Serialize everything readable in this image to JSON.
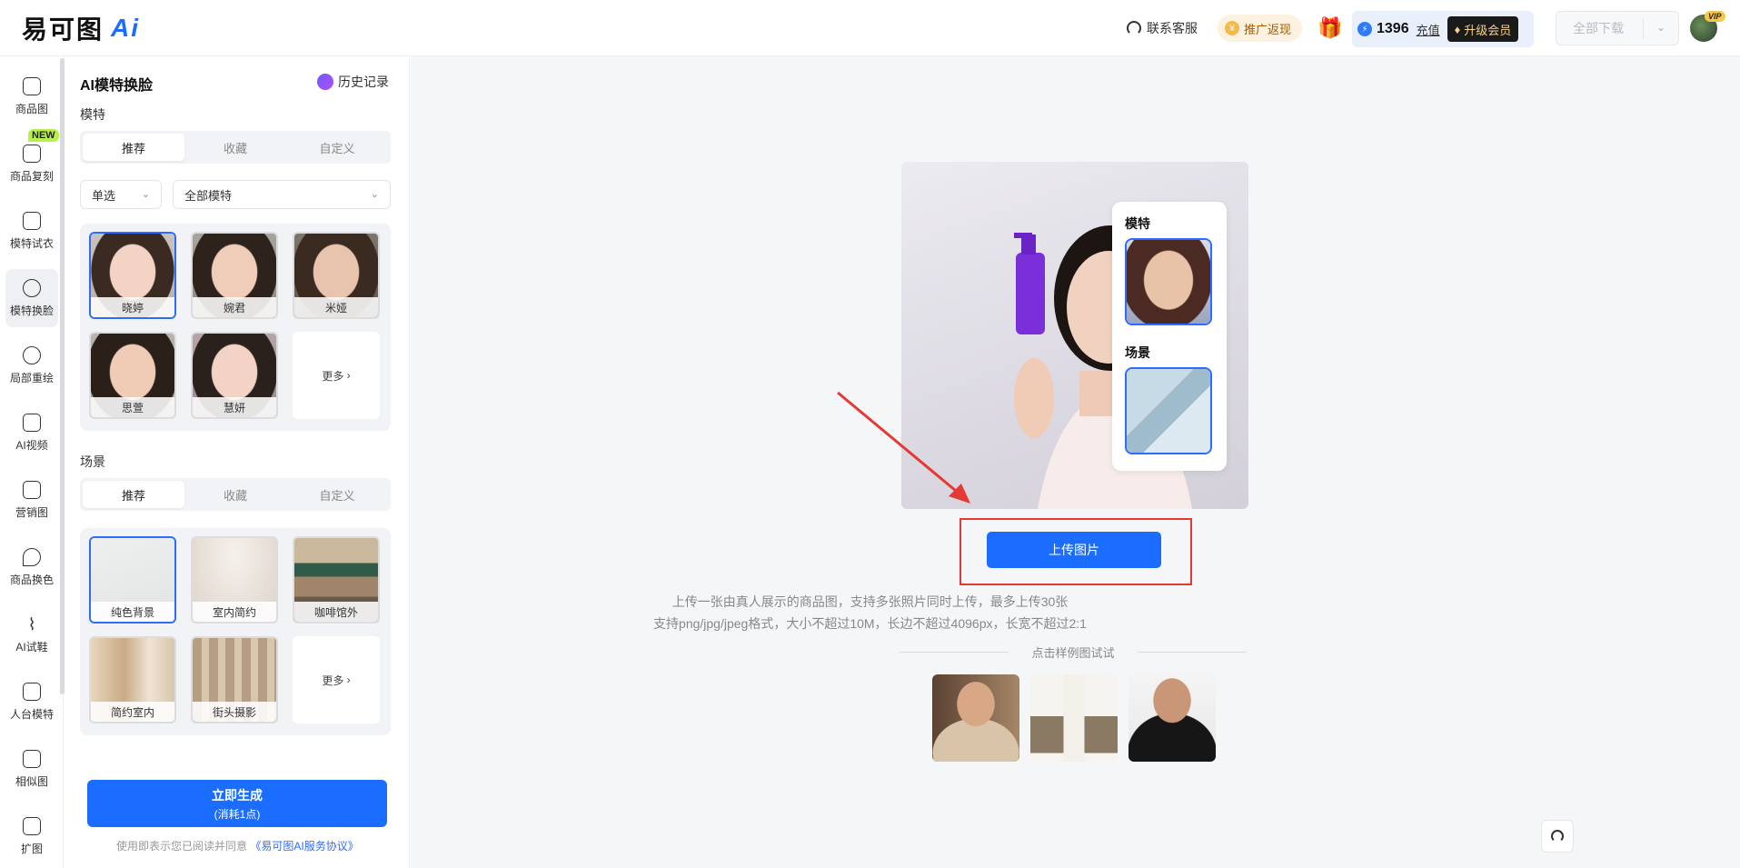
{
  "header": {
    "logo_text": "易可图",
    "logo_ai": "Ai",
    "customer_service": "联系客服",
    "promo": "推广返现",
    "points": "1396",
    "recharge": "充值",
    "upgrade": "升级会员",
    "download": "全部下载",
    "vip_tag": "VIP"
  },
  "nav": {
    "new_badge": "NEW",
    "items": [
      {
        "label": "商品图"
      },
      {
        "label": "商品复刻"
      },
      {
        "label": "模特试衣"
      },
      {
        "label": "模特换脸"
      },
      {
        "label": "局部重绘"
      },
      {
        "label": "AI视频"
      },
      {
        "label": "营销图"
      },
      {
        "label": "商品换色"
      },
      {
        "label": "AI试鞋"
      },
      {
        "label": "人台模特"
      },
      {
        "label": "相似图"
      },
      {
        "label": "扩图"
      }
    ]
  },
  "panel": {
    "title": "AI模特换脸",
    "history": "历史记录",
    "model_section": "模特",
    "model_tabs": [
      "推荐",
      "收藏",
      "自定义"
    ],
    "select_mode": "单选",
    "select_models": "全部模特",
    "models": [
      {
        "label": "晓婷"
      },
      {
        "label": "婉君"
      },
      {
        "label": "米娅"
      },
      {
        "label": "思萱"
      },
      {
        "label": "慧妍"
      }
    ],
    "more": "更多",
    "scene_section": "场景",
    "scene_tabs": [
      "推荐",
      "收藏",
      "自定义"
    ],
    "scenes": [
      {
        "label": "纯色背景"
      },
      {
        "label": "室内简约"
      },
      {
        "label": "咖啡馆外"
      },
      {
        "label": "简约室内"
      },
      {
        "label": "街头摄影"
      }
    ],
    "scene_more": "更多",
    "generate": "立即生成",
    "generate_cost": "(消耗1点)",
    "agree_prefix": "使用即表示您已阅读并同意",
    "agree_link": "《易可图AI服务协议》"
  },
  "main": {
    "overlay_model": "模特",
    "overlay_scene": "场景",
    "upload": "上传图片",
    "hint1": "上传一张由真人展示的商品图，支持多张照片同时上传，最多上传30张",
    "hint2": "支持png/jpg/jpeg格式，大小不超过10M，长边不超过4096px，长宽不超过2:1",
    "try_samples": "点击样例图试试"
  }
}
